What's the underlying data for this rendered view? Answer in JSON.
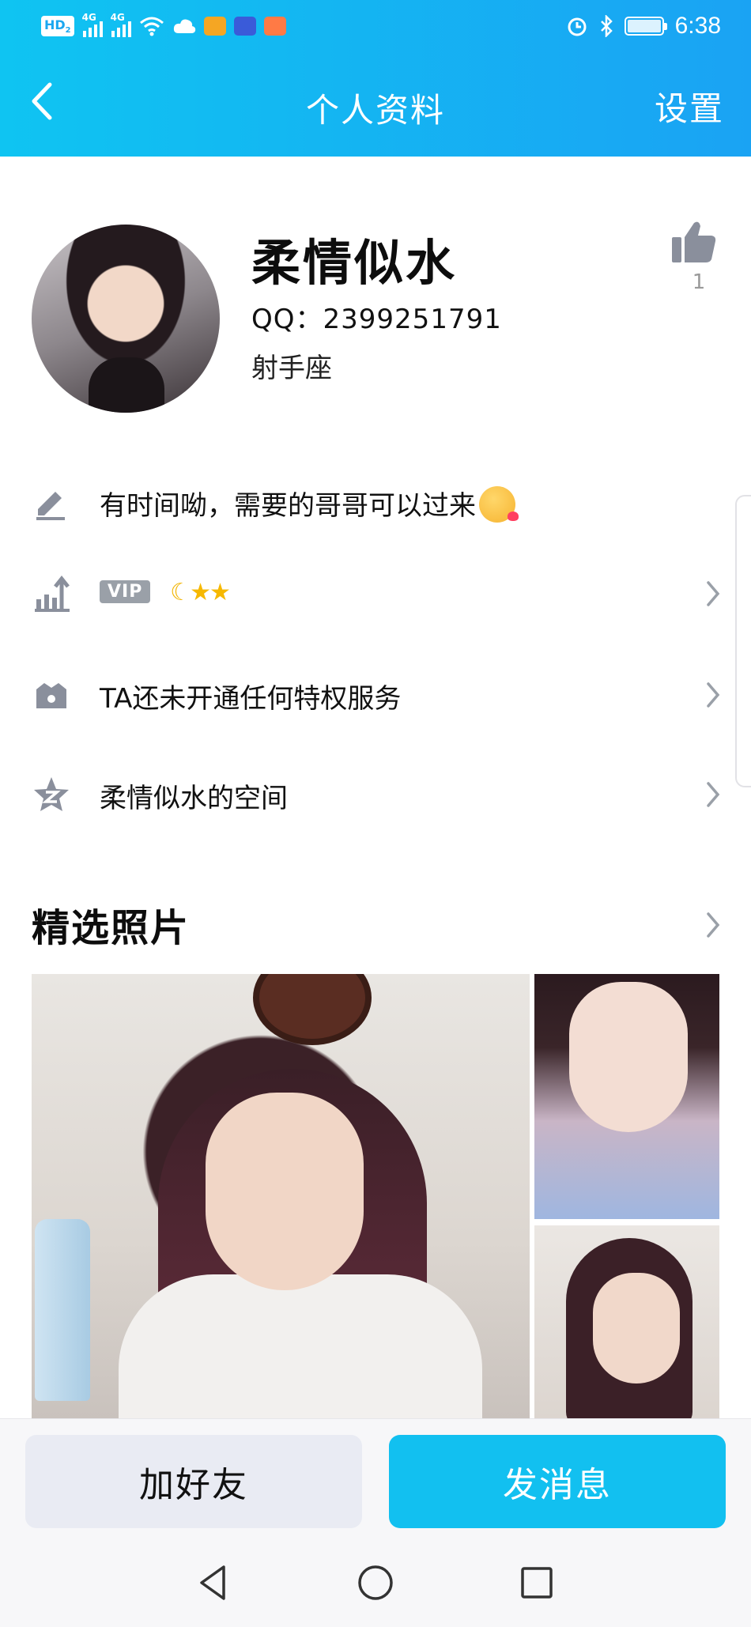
{
  "status_bar": {
    "hd_badge": "HD",
    "hd_sub": "2",
    "sig1": "4G",
    "sig2": "4G",
    "time": "6:38"
  },
  "navbar": {
    "title": "个人资料",
    "settings_label": "设置"
  },
  "profile": {
    "nickname": "柔情似水",
    "qq": "QQ：2399251791",
    "zodiac": "射手座",
    "like_count": "1"
  },
  "rows": {
    "signature": "有时间呦，需要的哥哥可以过来",
    "vip_badge": "VIP",
    "level_moon": "☾",
    "level_stars": "★★",
    "privilege": "TA还未开通任何特权服务",
    "space": "柔情似水的空间"
  },
  "photos": {
    "title": "精选照片"
  },
  "actions": {
    "add_friend": "加好友",
    "send_message": "发消息"
  },
  "colors": {
    "accent": "#12c0f0",
    "header_start": "#0fc4f2",
    "header_end": "#1aa3f3",
    "icon_gray": "#8a8f9c"
  },
  "icons": [
    "back-chevron-icon",
    "thumbs-up-icon",
    "pencil-icon",
    "level-up-icon",
    "crown-icon",
    "star-space-icon",
    "chevron-right-icon"
  ]
}
